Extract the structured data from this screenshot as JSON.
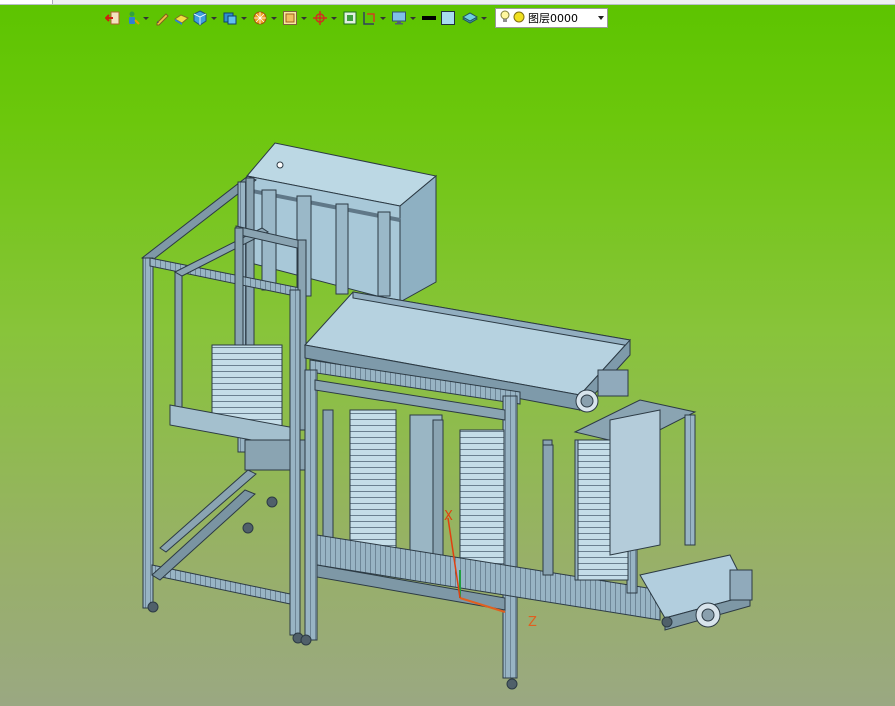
{
  "toolbar": {
    "buttons": [
      {
        "icon": "exit-icon",
        "dropdown": false
      },
      {
        "icon": "person-pointer-icon",
        "dropdown": true
      },
      {
        "icon": "pencil-icon",
        "dropdown": false
      },
      {
        "icon": "eraser-block-icon",
        "dropdown": false
      },
      {
        "icon": "cube-icon",
        "dropdown": true
      },
      {
        "icon": "shaded-cube-icon",
        "dropdown": true
      },
      {
        "icon": "sun-render-icon",
        "dropdown": true
      },
      {
        "icon": "frame-zoom-icon",
        "dropdown": true
      },
      {
        "icon": "crosshair-icon",
        "dropdown": true
      },
      {
        "icon": "box-select-icon",
        "dropdown": false
      },
      {
        "icon": "section-view-icon",
        "dropdown": true
      },
      {
        "icon": "monitor-icon",
        "dropdown": true
      },
      {
        "icon": "line-weight-icon",
        "dropdown": false
      },
      {
        "icon": "color-swatch-icon",
        "dropdown": false
      },
      {
        "icon": "layer-stack-icon",
        "dropdown": true
      }
    ],
    "layer_select": {
      "value": "图层0000",
      "icons": [
        "lightbulb-icon",
        "sun-dot-icon"
      ]
    }
  },
  "viewport": {
    "background_top": "#5cc400",
    "background_bottom": "#9aa882",
    "model_color": "#aed0e0",
    "frame_color": "#8aa8b8",
    "axes": {
      "x_label": "X",
      "z_label": "Z",
      "x_color": "#e04010",
      "y_color": "#20a040",
      "z_color": "#e06020"
    }
  }
}
